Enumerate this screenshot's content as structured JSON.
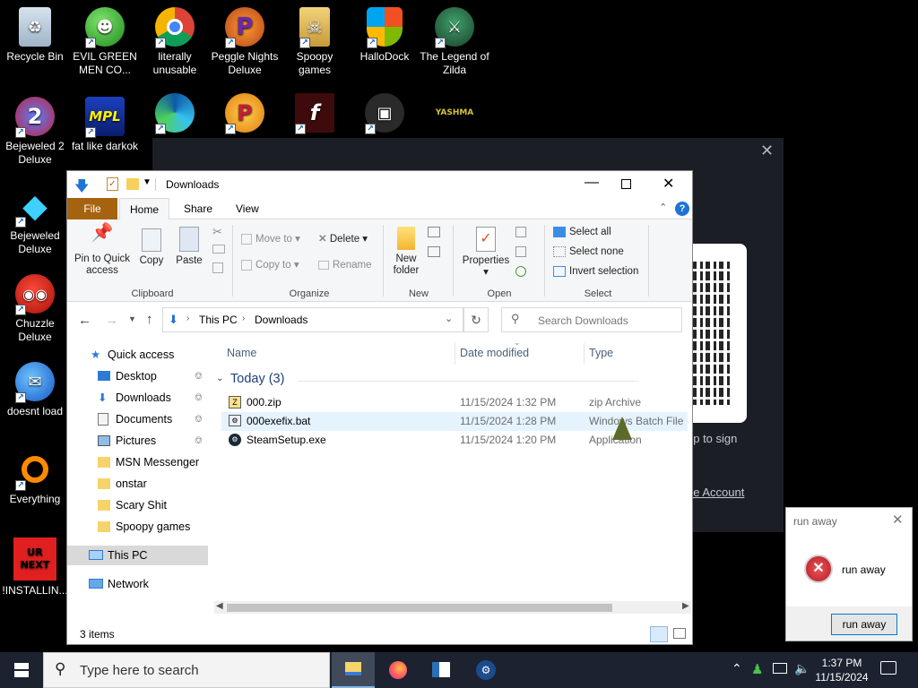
{
  "desktop": {
    "icons": [
      {
        "label": "Recycle Bin",
        "icon": "recycle-bin-icon"
      },
      {
        "label": "EVIL GREEN MEN CO...",
        "icon": "messenger-icon"
      },
      {
        "label": "literally unusable",
        "icon": "chrome-icon"
      },
      {
        "label": "Peggle Nights Deluxe",
        "icon": "peggle-icon"
      },
      {
        "label": "Spoopy games",
        "icon": "folder-icon"
      },
      {
        "label": "HalloDock",
        "icon": "windows-shield-icon"
      },
      {
        "label": "The Legend of Zilda",
        "icon": "zilda-icon"
      },
      {
        "label": "Bejeweled 2 Deluxe",
        "icon": "bejeweled2-icon"
      },
      {
        "label": "fat like darkok",
        "icon": "mpl-icon"
      },
      {
        "label": "Bejeweled Deluxe",
        "icon": "diamond-icon"
      },
      {
        "label": "Chuzzle Deluxe",
        "icon": "chuzzle-icon"
      },
      {
        "label": "doesnt load",
        "icon": "thunderbird-icon"
      },
      {
        "label": "Everything",
        "icon": "everything-icon"
      },
      {
        "label": "!INSTALLIN...",
        "icon": "urnext-icon"
      }
    ],
    "urnext_text_top": "UR",
    "urnext_text_bottom": "NEXT",
    "mpl_text": "MPL",
    "yashma_text": "YASHMA"
  },
  "steam": {
    "app_to_sign": "pp to sign",
    "see_account": "ee Account"
  },
  "explorer": {
    "title": "Downloads",
    "tabs": {
      "file": "File",
      "home": "Home",
      "share": "Share",
      "view": "View"
    },
    "ribbon": {
      "pin": "Pin to Quick access",
      "copy": "Copy",
      "paste": "Paste",
      "move_to": "Move to",
      "copy_to": "Copy to",
      "delete": "Delete",
      "rename": "Rename",
      "new_folder": "New folder",
      "properties": "Properties",
      "select_all": "Select all",
      "select_none": "Select none",
      "invert_selection": "Invert selection",
      "groups": {
        "clipboard": "Clipboard",
        "organize": "Organize",
        "new": "New",
        "open": "Open",
        "select": "Select"
      }
    },
    "address": {
      "this_pc": "This PC",
      "downloads": "Downloads",
      "search_placeholder": "Search Downloads"
    },
    "nav": {
      "quick_access": "Quick access",
      "items": [
        {
          "label": "Desktop",
          "pinned": true
        },
        {
          "label": "Downloads",
          "pinned": true
        },
        {
          "label": "Documents",
          "pinned": true
        },
        {
          "label": "Pictures",
          "pinned": true
        },
        {
          "label": "MSN Messenger",
          "pinned": false
        },
        {
          "label": "onstar",
          "pinned": false
        },
        {
          "label": "Scary Shit",
          "pinned": false
        },
        {
          "label": "Spoopy games",
          "pinned": false
        }
      ],
      "this_pc": "This PC",
      "network": "Network"
    },
    "columns": {
      "name": "Name",
      "date": "Date modified",
      "type": "Type"
    },
    "group_header": "Today (3)",
    "files": [
      {
        "name": "000.zip",
        "date": "11/15/2024 1:32 PM",
        "type": "zip Archive"
      },
      {
        "name": "000exefix.bat",
        "date": "11/15/2024 1:28 PM",
        "type": "Windows Batch File"
      },
      {
        "name": "SteamSetup.exe",
        "date": "11/15/2024 1:20 PM",
        "type": "Application"
      }
    ],
    "status": "3 items"
  },
  "dialog": {
    "title": "run away",
    "message": "run away",
    "button": "run away"
  },
  "taskbar": {
    "search_placeholder": "Type here to search",
    "time": "1:37 PM",
    "date": "11/15/2024"
  }
}
